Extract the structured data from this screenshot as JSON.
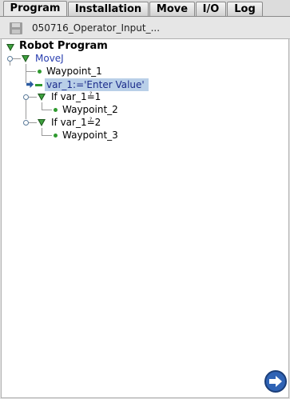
{
  "tabs": [
    {
      "label": "Program",
      "active": true
    },
    {
      "label": "Installation",
      "active": false
    },
    {
      "label": "Move",
      "active": false
    },
    {
      "label": "I/O",
      "active": false
    },
    {
      "label": "Log",
      "active": false
    }
  ],
  "file": {
    "icon": "floppy-disk-icon",
    "name": "050716_Operator_Input_..."
  },
  "tree": {
    "root": "Robot Program",
    "movej": "MoveJ",
    "waypoint_1": "Waypoint_1",
    "assignment": "var_1:='Enter Value'",
    "if_1": "If var_1≟1",
    "waypoint_2": "Waypoint_2",
    "if_2": "If var_1≟2",
    "waypoint_3": "Waypoint_3"
  },
  "colors": {
    "selection": "#b9cfe8",
    "node_green": "#2f9a2f",
    "movej_text": "#2a3fb0",
    "assignment_text": "#1a2a8a",
    "next_button": "#2f63b5"
  },
  "icons": {
    "next": "arrow-right-icon",
    "current_line": "current-line-arrow-icon"
  }
}
